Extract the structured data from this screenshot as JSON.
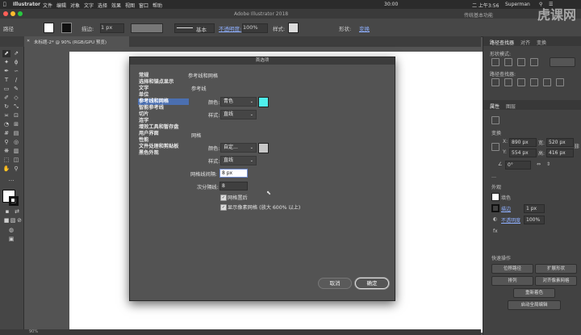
{
  "menubar": {
    "app": "Illustrator",
    "items": [
      "文件",
      "编辑",
      "对象",
      "文字",
      "选择",
      "效果",
      "视图",
      "窗口",
      "帮助"
    ],
    "right_time": "30:00",
    "right_date": "二 上午3:56",
    "user": "Superman"
  },
  "titlebar": {
    "title": "Adobe Illustrator 2018",
    "right_label": "传统基本功能"
  },
  "controlbar": {
    "path_label": "路径",
    "stroke_label": "描边:",
    "stroke_value": "1 px",
    "brush_label": "基本",
    "opacity_label": "不透明度:",
    "opacity_value": "100%",
    "style_label": "样式:",
    "shape_label": "形状:",
    "transform_label": "变换"
  },
  "doc_tab": {
    "title": "未标题-2* @ 90% (RGB/GPU 预览)"
  },
  "statusbar": {
    "zoom": "90%"
  },
  "dialog": {
    "title": "首选项",
    "categories": [
      "常规",
      "选择和锚点显示",
      "文字",
      "单位",
      "参考线和网格",
      "智能参考线",
      "切片",
      "连字",
      "增效工具和暂存盘",
      "用户界面",
      "性能",
      "文件处理和剪贴板",
      "黑色外观"
    ],
    "selected_category": "参考线和网格",
    "section_title": "参考线和网格",
    "guides": {
      "heading": "参考线",
      "color_label": "颜色:",
      "color_value": "青色",
      "color_swatch": "#4ff0ec",
      "style_label": "样式:",
      "style_value": "直线"
    },
    "grid": {
      "heading": "网格",
      "color_label": "颜色:",
      "color_value": "自定...",
      "color_swatch": "#c8c8c8",
      "style_label": "样式:",
      "style_value": "直线",
      "gridline_label": "网格线间隔:",
      "gridline_value": "8 px",
      "subdiv_label": "次分隔线:",
      "subdiv_value": "8",
      "grids_in_back": "网格置后",
      "show_pixel_grid": "显示像素网格 (放大 600% 以上)"
    },
    "cancel_label": "取消",
    "ok_label": "确定"
  },
  "right_panel": {
    "tabs": [
      "路径查找器",
      "对齐",
      "变换"
    ],
    "shape_modes_label": "形状模式:",
    "pathfinder_label": "路径查找器:",
    "properties_tab": "属性",
    "layers_tab": "图层",
    "transform_label": "变换",
    "x_label": "X:",
    "x_value": "890 px",
    "y_label": "Y:",
    "y_value": "554 px",
    "w_label": "宽:",
    "w_value": "520 px",
    "h_label": "高:",
    "h_value": "416 px",
    "angle_value": "0°",
    "appearance_label": "外观",
    "fill_label": "填色",
    "stroke_label": "描边",
    "stroke_value": "1 px",
    "opacity_label": "不透明度",
    "opacity_value": "100%",
    "quick_actions_label": "快速操作",
    "btn_offset_path": "位移路径",
    "btn_expand_shape": "扩展形状",
    "btn_arrange": "排列",
    "btn_align_pixel": "对齐像素网格",
    "btn_recolor": "重新着色",
    "btn_global_edit": "启动全局编辑"
  },
  "watermark": "虎课网",
  "colors": {
    "accent": "#4b6fb0",
    "dialog_bg": "#535353",
    "panel_bg": "#424242"
  }
}
